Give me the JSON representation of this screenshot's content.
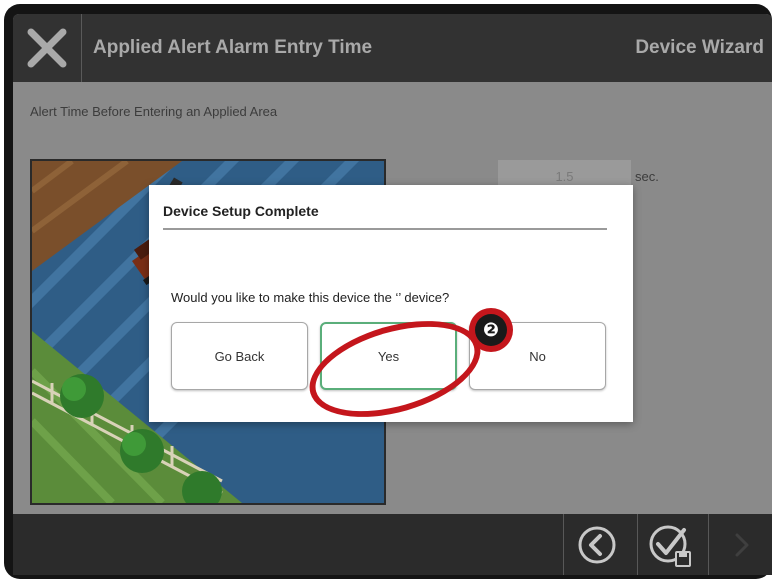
{
  "header": {
    "close_icon": "close-icon",
    "title": "Applied Alert Alarm Entry Time",
    "wizard_label": "Device Wizard"
  },
  "content": {
    "subtitle": "Alert Time Before Entering an Applied Area",
    "time_value": "1.5",
    "time_unit": "sec."
  },
  "dialog": {
    "title": "Device Setup Complete",
    "question": "Would you like to make this device the ‘’ device?",
    "buttons": {
      "go_back": "Go Back",
      "yes": "Yes",
      "no": "No"
    },
    "selected": "yes"
  },
  "footer": {
    "icons": [
      "back-icon",
      "save-check-icon",
      "next-icon"
    ]
  },
  "annotation": {
    "badge": "❷"
  },
  "colors": {
    "header_bg": "#323232",
    "selected_border": "#5aae7a",
    "callout": "#c4161c"
  }
}
